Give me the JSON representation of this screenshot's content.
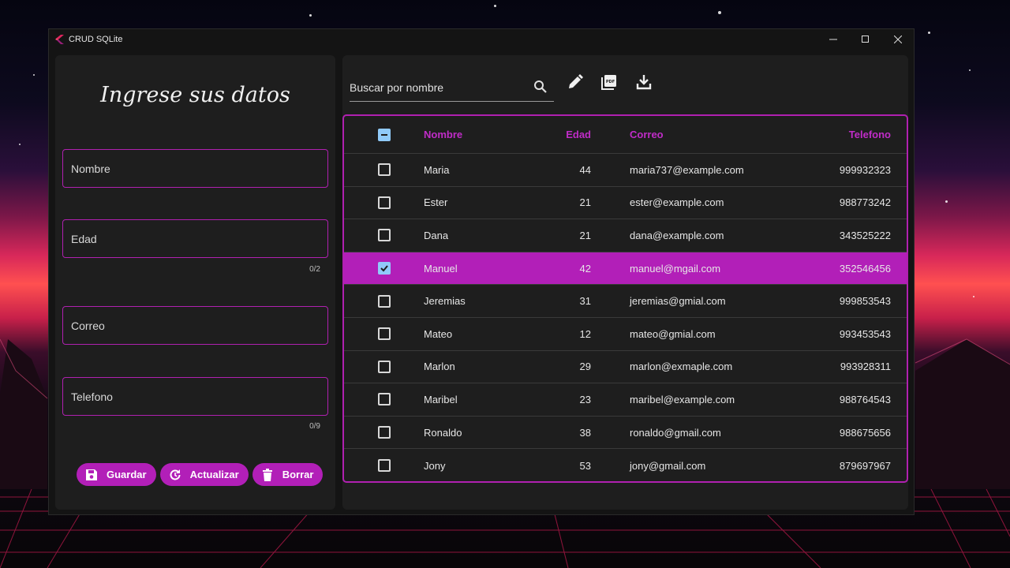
{
  "window": {
    "title": "CRUD SQLite"
  },
  "form": {
    "title": "Ingrese sus datos",
    "fields": {
      "nombre": "Nombre",
      "edad": "Edad",
      "edad_counter": "0/2",
      "correo": "Correo",
      "telefono": "Telefono",
      "telefono_counter": "0/9"
    },
    "buttons": {
      "save": "Guardar",
      "update": "Actualizar",
      "delete": "Borrar"
    }
  },
  "search": {
    "placeholder": "Buscar por nombre"
  },
  "table": {
    "headers": {
      "name": "Nombre",
      "age": "Edad",
      "mail": "Correo",
      "phone": "Telefono"
    },
    "rows": [
      {
        "name": "Maria",
        "age": "44",
        "mail": "maria737@example.com",
        "phone": "999932323",
        "checked": false
      },
      {
        "name": "Ester",
        "age": "21",
        "mail": "ester@example.com",
        "phone": "988773242",
        "checked": false
      },
      {
        "name": "Dana",
        "age": "21",
        "mail": "dana@example.com",
        "phone": "343525222",
        "checked": false
      },
      {
        "name": "Manuel",
        "age": "42",
        "mail": "manuel@mgail.com",
        "phone": "352546456",
        "checked": true
      },
      {
        "name": "Jeremias",
        "age": "31",
        "mail": "jeremias@gmial.com",
        "phone": "999853543",
        "checked": false
      },
      {
        "name": "Mateo",
        "age": "12",
        "mail": "mateo@gmial.com",
        "phone": "993453543",
        "checked": false
      },
      {
        "name": "Marlon",
        "age": "29",
        "mail": "marlon@exmaple.com",
        "phone": "993928311",
        "checked": false
      },
      {
        "name": "Maribel",
        "age": "23",
        "mail": "maribel@example.com",
        "phone": "988764543",
        "checked": false
      },
      {
        "name": "Ronaldo",
        "age": "38",
        "mail": "ronaldo@gmail.com",
        "phone": "988675656",
        "checked": false
      },
      {
        "name": "Jony",
        "age": "53",
        "mail": "jony@gmail.com",
        "phone": "879697967",
        "checked": false
      }
    ]
  },
  "colors": {
    "accent": "#b21fb8",
    "checkbox": "#90caf9",
    "panel": "#1e1e1e"
  }
}
